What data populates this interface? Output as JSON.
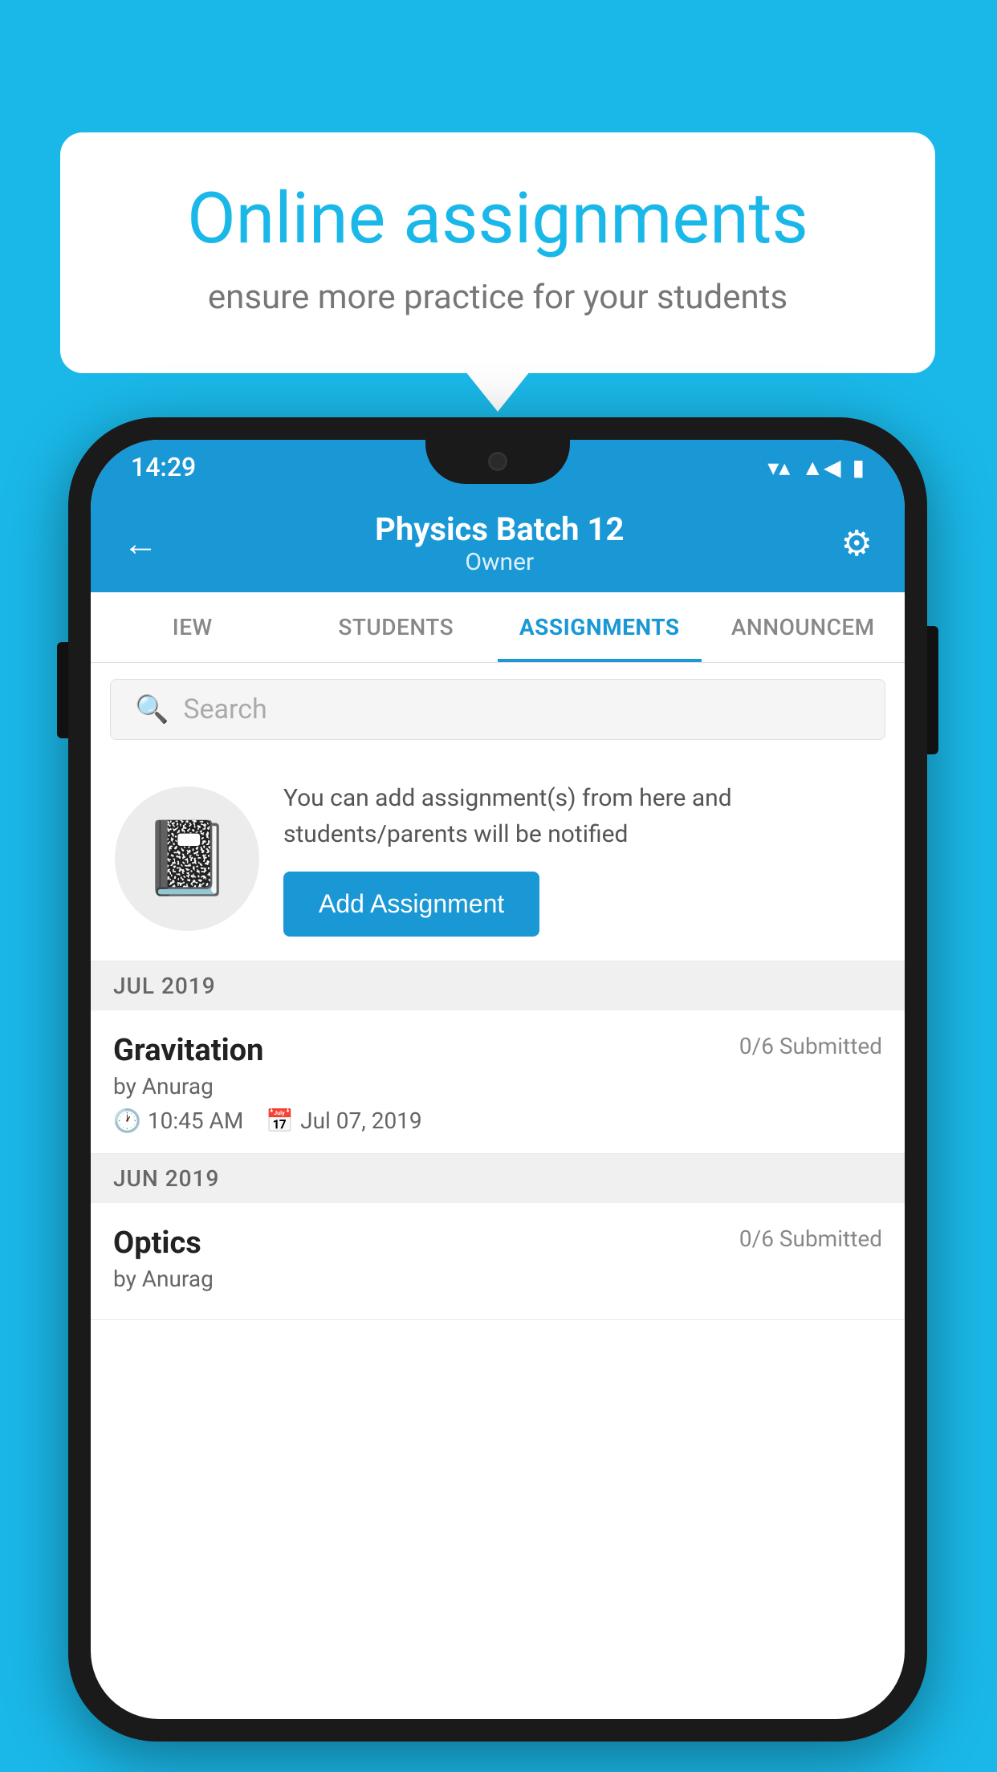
{
  "background_color": "#1ab8e8",
  "speech_bubble": {
    "title": "Online assignments",
    "subtitle": "ensure more practice for your students"
  },
  "status_bar": {
    "time": "14:29",
    "icons": [
      "wifi",
      "signal",
      "battery"
    ]
  },
  "header": {
    "title": "Physics Batch 12",
    "subtitle": "Owner",
    "back_label": "←",
    "gear_label": "⚙"
  },
  "tabs": [
    {
      "label": "IEW",
      "active": false
    },
    {
      "label": "STUDENTS",
      "active": false
    },
    {
      "label": "ASSIGNMENTS",
      "active": true
    },
    {
      "label": "ANNOUNCEM",
      "active": false
    }
  ],
  "search": {
    "placeholder": "Search"
  },
  "add_assignment_section": {
    "description": "You can add assignment(s) from here and students/parents will be notified",
    "button_label": "Add Assignment"
  },
  "sections": [
    {
      "header": "JUL 2019",
      "items": [
        {
          "name": "Gravitation",
          "submitted": "0/6 Submitted",
          "by": "by Anurag",
          "time": "10:45 AM",
          "date": "Jul 07, 2019"
        }
      ]
    },
    {
      "header": "JUN 2019",
      "items": [
        {
          "name": "Optics",
          "submitted": "0/6 Submitted",
          "by": "by Anurag",
          "time": "",
          "date": ""
        }
      ]
    }
  ]
}
